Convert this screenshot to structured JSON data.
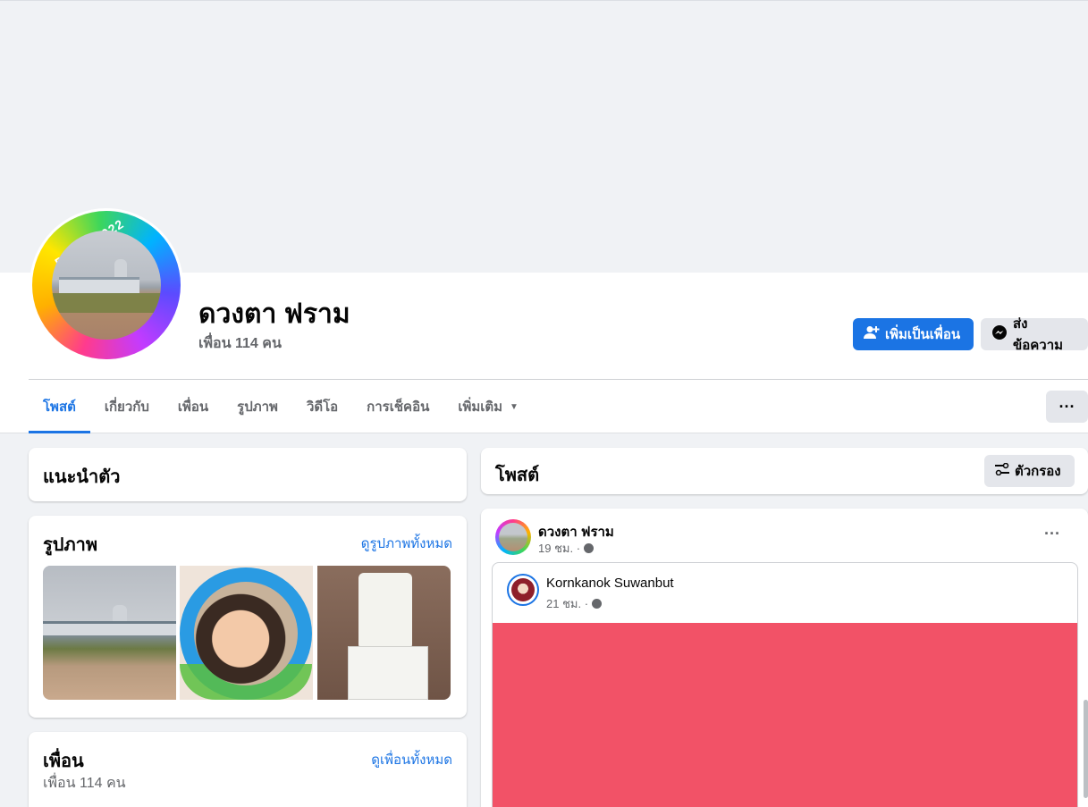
{
  "profile": {
    "name": "ดวงตา ฟราม",
    "friends_count": "เพื่อน 114 คน",
    "pride_label": "PRIDE 2022"
  },
  "actions": {
    "add_friend": "เพิ่มเป็นเพื่อน",
    "message": "ส่งข้อความ"
  },
  "tabs": [
    {
      "label": "โพสต์"
    },
    {
      "label": "เกี่ยวกับ"
    },
    {
      "label": "เพื่อน"
    },
    {
      "label": "รูปภาพ"
    },
    {
      "label": "วิดีโอ"
    },
    {
      "label": "การเช็คอิน"
    },
    {
      "label": "เพิ่มเติม"
    }
  ],
  "intro": {
    "title": "แนะนำตัว"
  },
  "photos": {
    "title": "รูปภาพ",
    "see_all": "ดูรูปภาพทั้งหมด"
  },
  "friends": {
    "title": "เพื่อน",
    "see_all": "ดูเพื่อนทั้งหมด",
    "count": "เพื่อน 114 คน"
  },
  "posts": {
    "title": "โพสต์",
    "filter": "ตัวกรอง"
  },
  "post": {
    "author": "ดวงตา ฟราม",
    "time": "19 ชม. ·",
    "more": "···",
    "shared": {
      "author": "Kornkanok Suwanbut",
      "time": "21 ชม. ·",
      "background": "#f25267"
    }
  },
  "colors": {
    "accent": "#1b74e4",
    "page_bg": "#f0f2f5"
  }
}
